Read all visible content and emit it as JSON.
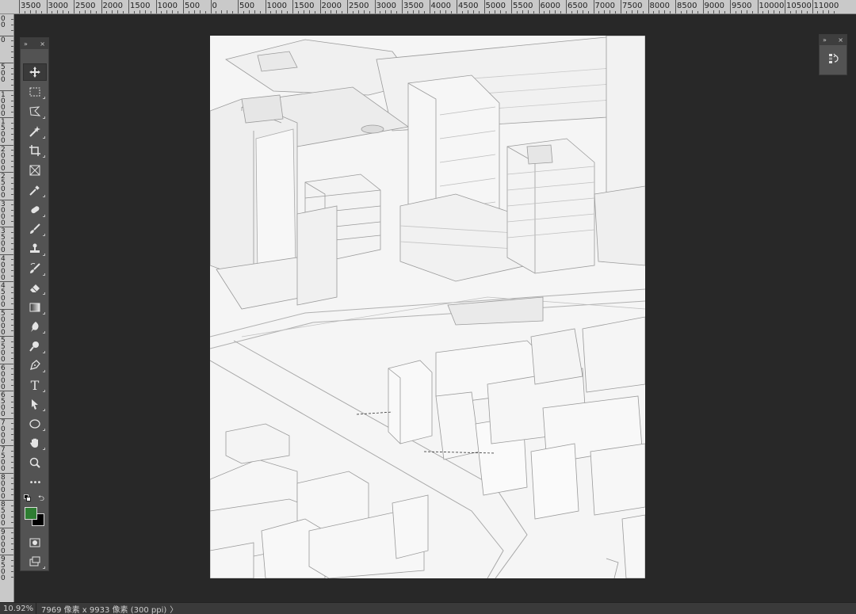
{
  "ruler": {
    "top_labels": [
      "3500",
      "3000",
      "2500",
      "2000",
      "1500",
      "1000",
      "500",
      "0",
      "500",
      "1000",
      "1500",
      "2000",
      "2500",
      "3000",
      "3500",
      "4000",
      "4500",
      "5000",
      "5500",
      "6000",
      "6500",
      "7000",
      "7500",
      "8000",
      "8500",
      "9000",
      "9500",
      "10000",
      "10500",
      "11000"
    ],
    "left_labels": [
      "500",
      "0",
      "500",
      "1000",
      "1500",
      "2000",
      "2500",
      "3000",
      "3500",
      "4000",
      "4500",
      "5000",
      "5500",
      "6000",
      "6500",
      "7000",
      "7500",
      "8000",
      "8500",
      "9000",
      "9500"
    ]
  },
  "toolbar": {
    "collapse_label": "»",
    "close_label": "×",
    "tools": [
      {
        "name": "move-tool",
        "icon": "move-icon"
      },
      {
        "name": "marquee-tool",
        "icon": "rect-marquee-icon"
      },
      {
        "name": "lasso-tool",
        "icon": "polygon-lasso-icon"
      },
      {
        "name": "magic-wand-tool",
        "icon": "magic-wand-icon"
      },
      {
        "name": "crop-tool",
        "icon": "crop-icon"
      },
      {
        "name": "frame-tool",
        "icon": "frame-icon"
      },
      {
        "name": "eyedropper-tool",
        "icon": "eyedropper-icon"
      },
      {
        "name": "healing-brush-tool",
        "icon": "bandage-icon"
      },
      {
        "name": "brush-tool",
        "icon": "brush-icon"
      },
      {
        "name": "clone-stamp-tool",
        "icon": "stamp-icon"
      },
      {
        "name": "history-brush-tool",
        "icon": "history-brush-icon"
      },
      {
        "name": "eraser-tool",
        "icon": "eraser-icon"
      },
      {
        "name": "gradient-tool",
        "icon": "gradient-icon"
      },
      {
        "name": "blur-tool",
        "icon": "drop-icon"
      },
      {
        "name": "dodge-tool",
        "icon": "dodge-icon"
      },
      {
        "name": "pen-tool",
        "icon": "pen-icon"
      },
      {
        "name": "type-tool",
        "icon": "type-icon"
      },
      {
        "name": "path-selection-tool",
        "icon": "arrow-cursor-icon"
      },
      {
        "name": "shape-tool",
        "icon": "ellipse-icon"
      },
      {
        "name": "hand-tool",
        "icon": "hand-icon"
      },
      {
        "name": "zoom-tool",
        "icon": "magnifier-icon"
      },
      {
        "name": "edit-toolbar",
        "icon": "more-icon"
      }
    ],
    "type_glyph": "T",
    "more_glyph": "•••",
    "foreground_color": "#2e7d32",
    "background_color": "#000000"
  },
  "right_panel": {
    "collapse_label": "»",
    "close_label": "×",
    "icon": "history-panel-icon"
  },
  "status": {
    "zoom": "10.92%",
    "doc_info": "7969 像素 x 9933 像素 (300 ppi)",
    "arrow": "〉"
  }
}
